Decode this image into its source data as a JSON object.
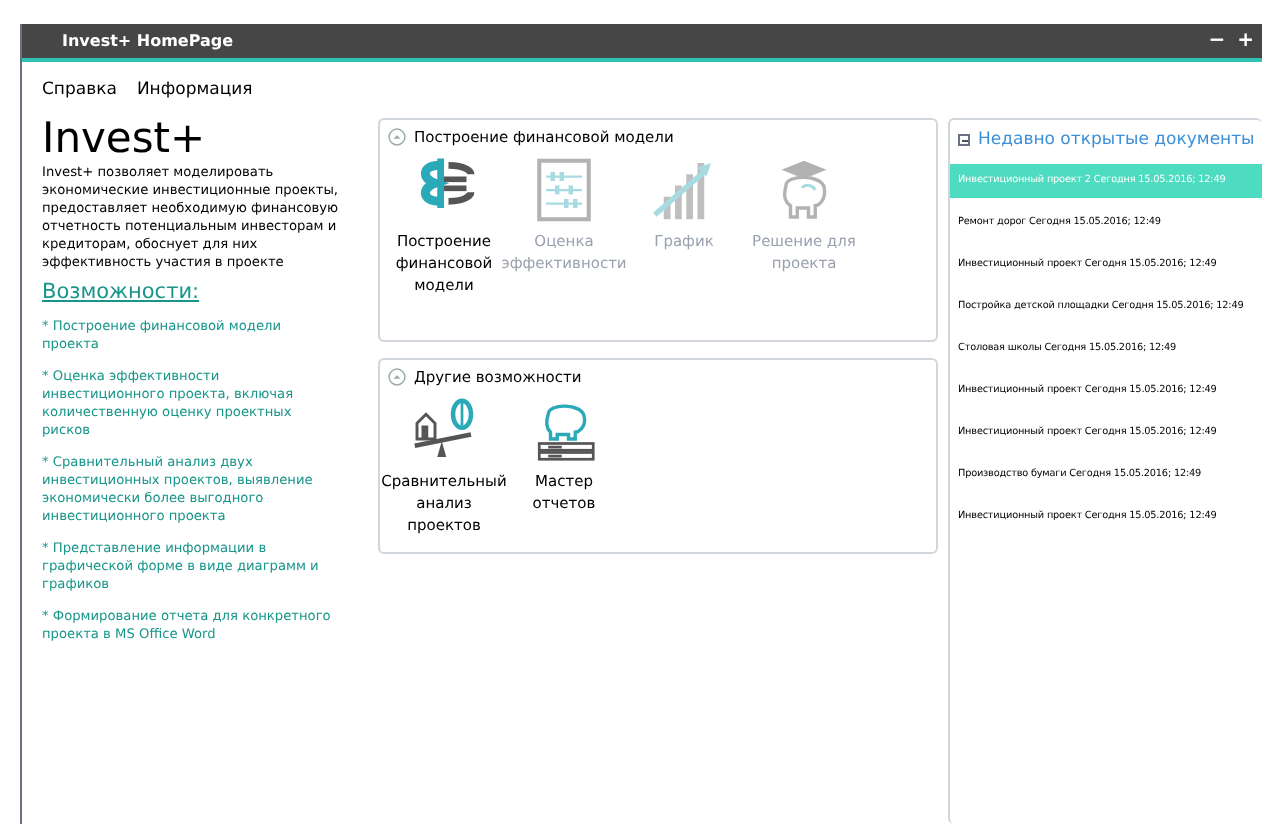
{
  "window": {
    "title": "Invest+ HomePage",
    "controls": [
      "−",
      "+"
    ]
  },
  "menu": [
    "Справка",
    "Информация"
  ],
  "about": {
    "title": "Invest+",
    "description": "Invest+ позволяет моделировать экономические инвестиционные проекты, предоставляет необходимую финансовую отчетность потенциальным инвесторам и кредиторам, обоснует для них эффективность участия в проекте",
    "features_title": "Возможности:",
    "features": [
      "* Построение финансовой модели проекта",
      "* Оценка эффективности инвестиционного проекта, включая количественную оценку проектных рисков",
      "* Сравнительный анализ двух инвестиционных проектов, выявление экономически более выгодного инвестиционного проекта",
      "* Представление информации в графической форме в виде диаграмм и графиков",
      "* Формирование отчета для конкретного проекта в MS Office Word"
    ]
  },
  "sections": [
    {
      "title": "Построение финансовой модели",
      "expanded": true,
      "items": [
        {
          "label": "Построение финансовой модели",
          "disabled": false
        },
        {
          "label": "Оценка эффективности",
          "disabled": true
        },
        {
          "label": "График",
          "disabled": true
        },
        {
          "label": "Решение для проекта",
          "disabled": true
        }
      ]
    },
    {
      "title": "Другие возможности",
      "expanded": true,
      "items": [
        {
          "label": "Сравнительный анализ проектов",
          "disabled": false
        },
        {
          "label": "Мастер отчетов",
          "disabled": false
        }
      ]
    }
  ],
  "recent": {
    "title": "Недавно открытые документы",
    "expanded": true,
    "items": [
      {
        "label": "Инвестиционный проект 2 Сегодня 15.05.2016; 12:49",
        "selected": true
      },
      {
        "label": "Ремонт дорог Сегодня 15.05.2016; 12:49",
        "selected": false
      },
      {
        "label": "Инвестиционный проект Сегодня 15.05.2016; 12:49",
        "selected": false
      },
      {
        "label": "Постройка детской площадки Сегодня 15.05.2016; 12:49",
        "selected": false
      },
      {
        "label": "Столовая школы Сегодня 15.05.2016; 12:49",
        "selected": false
      },
      {
        "label": "Инвестиционный проект Сегодня 15.05.2016; 12:49",
        "selected": false
      },
      {
        "label": "Инвестиционный проект Сегодня 15.05.2016; 12:49",
        "selected": false
      },
      {
        "label": "Производство бумаги Сегодня 15.05.2016; 12:49",
        "selected": false
      },
      {
        "label": "Инвестиционный проект Сегодня 15.05.2016; 12:49",
        "selected": false
      }
    ]
  }
}
